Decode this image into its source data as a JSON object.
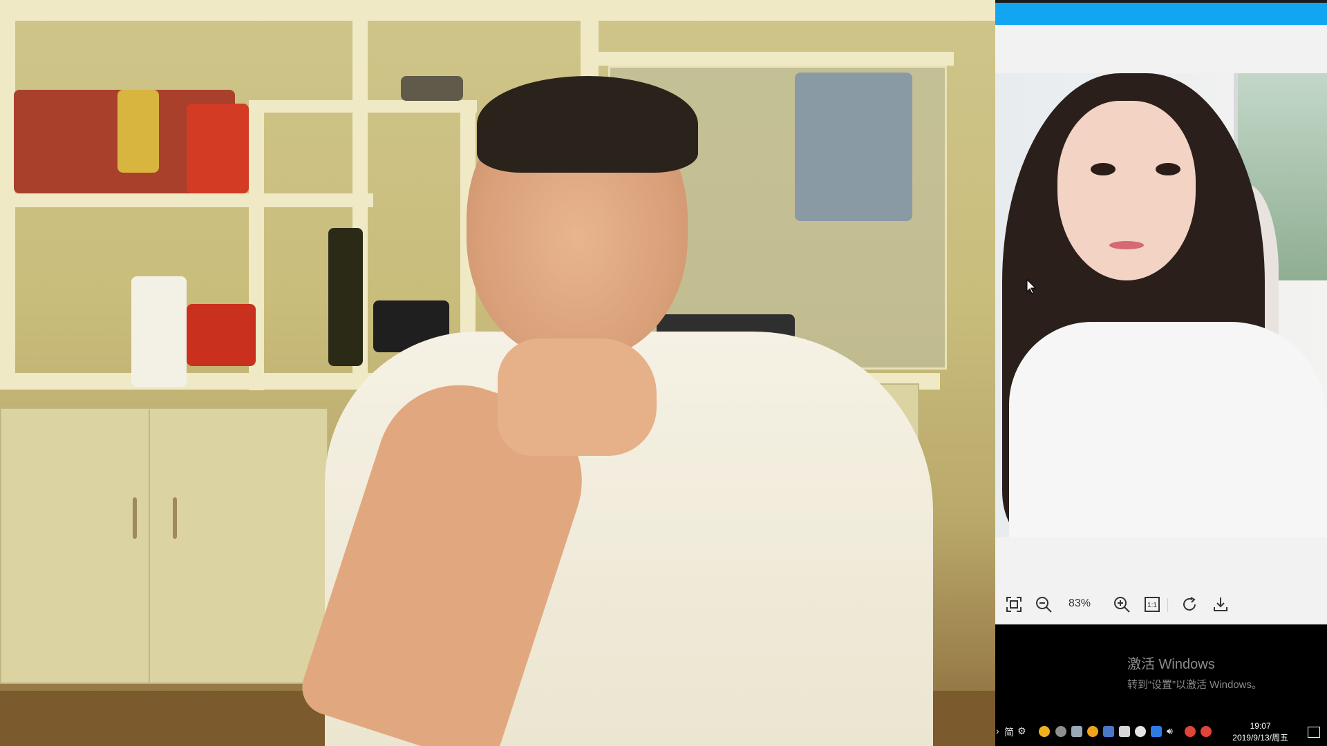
{
  "viewer": {
    "zoom_label": "83%",
    "toolbar_icons": [
      "fit-screen-icon",
      "zoom-out-icon",
      "zoom-in-icon",
      "actual-size-icon",
      "rotate-icon",
      "download-icon"
    ],
    "actual_size_label": "1:1"
  },
  "watermark": {
    "line1": "激活 Windows",
    "line2": "转到“设置”以激活 Windows。"
  },
  "taskbar": {
    "ime_label": "简",
    "time": "19:07",
    "date": "2019/9/13/周五"
  },
  "colors": {
    "titlebar": "#12a6f2"
  }
}
